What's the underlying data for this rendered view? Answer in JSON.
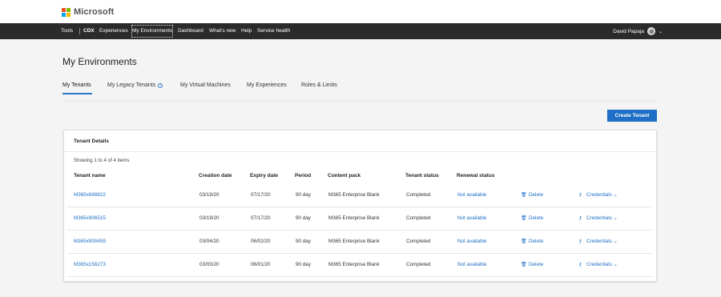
{
  "brand": {
    "name": "Microsoft",
    "logo_colors": [
      "#f25022",
      "#7fba00",
      "#00a4ef",
      "#ffb900"
    ]
  },
  "nav": {
    "tools": "Tools",
    "cdx": "CDX",
    "experiences": "Experiences",
    "my_environments": "My Environments",
    "dashboard": "Dashboard",
    "whats_new": "What's new",
    "help": "Help",
    "service_health": "Service health",
    "user_name": "David Papaja"
  },
  "page": {
    "title": "My Environments",
    "tabs": [
      "My Tenants",
      "My Legacy Tenants",
      "My Virtual Machines",
      "My Experiences",
      "Roles & Limits"
    ],
    "create_button": "Create Tenant"
  },
  "card": {
    "title": "Tenant Details",
    "showing": "Showing 1 to 4 of 4 items",
    "columns": [
      "Tenant name",
      "Creation date",
      "Expiry date",
      "Period",
      "Content pack",
      "Tenant status",
      "Renewal status"
    ],
    "rows": [
      {
        "name": "M365x698822",
        "created": "03/19/20",
        "expiry": "07/17/20",
        "period": "90 day",
        "pack": "M365 Enterprise Blank",
        "status": "Completed",
        "renewal": "Not available",
        "delete": "Delete",
        "credentials": "Credentials"
      },
      {
        "name": "M365x906515",
        "created": "03/19/20",
        "expiry": "07/17/20",
        "period": "90 day",
        "pack": "M365 Enterprise Blank",
        "status": "Completed",
        "renewal": "Not available",
        "delete": "Delete",
        "credentials": "Credentials"
      },
      {
        "name": "M365x900459",
        "created": "03/04/20",
        "expiry": "06/02/20",
        "period": "90 day",
        "pack": "M365 Enterprise Blank",
        "status": "Completed",
        "renewal": "Not available",
        "delete": "Delete",
        "credentials": "Credentials"
      },
      {
        "name": "M365x156273",
        "created": "03/03/20",
        "expiry": "06/01/20",
        "period": "90 day",
        "pack": "M365 Enterprise Blank",
        "status": "Completed",
        "renewal": "Not available",
        "delete": "Delete",
        "credentials": "Credentials"
      }
    ]
  },
  "colors": {
    "accent": "#1e6fc5",
    "navbar": "#2b2b2b"
  }
}
